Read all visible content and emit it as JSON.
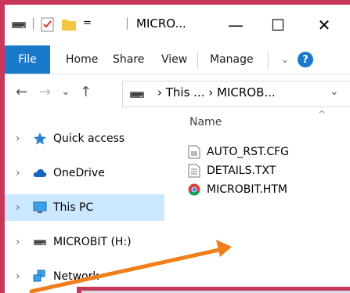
{
  "titlebar": {
    "title": "MICRO...",
    "separator1": "|",
    "dropdown": "=",
    "separator2": "|",
    "minimize": "—",
    "maximize": "☐",
    "close": "✕"
  },
  "ribbon": {
    "tabs": [
      {
        "label": "File"
      },
      {
        "label": "Home"
      },
      {
        "label": "Share"
      },
      {
        "label": "View"
      },
      {
        "label": "Manage"
      }
    ],
    "expand": "⌄",
    "help": "?"
  },
  "address": {
    "back": "←",
    "forward": "→",
    "recent": "⌄",
    "up": "↑",
    "path": "› This ...  › MICROB...",
    "dropdown": "⌄"
  },
  "navpane": {
    "items": [
      {
        "label": "Quick access"
      },
      {
        "label": "OneDrive"
      },
      {
        "label": "This PC"
      },
      {
        "label": "MICROBIT (H:)"
      },
      {
        "label": "Network"
      }
    ]
  },
  "content": {
    "column_header": "Name",
    "files": [
      {
        "name": "AUTO_RST.CFG",
        "icon": "cfg-file-icon"
      },
      {
        "name": "DETAILS.TXT",
        "icon": "text-file-icon"
      },
      {
        "name": "MICROBIT.HTM",
        "icon": "chrome-icon"
      }
    ]
  },
  "colors": {
    "frame": "#c8385a",
    "file_tab": "#1979ca",
    "selection": "#cce8ff",
    "arrow": "#f07e1a"
  }
}
